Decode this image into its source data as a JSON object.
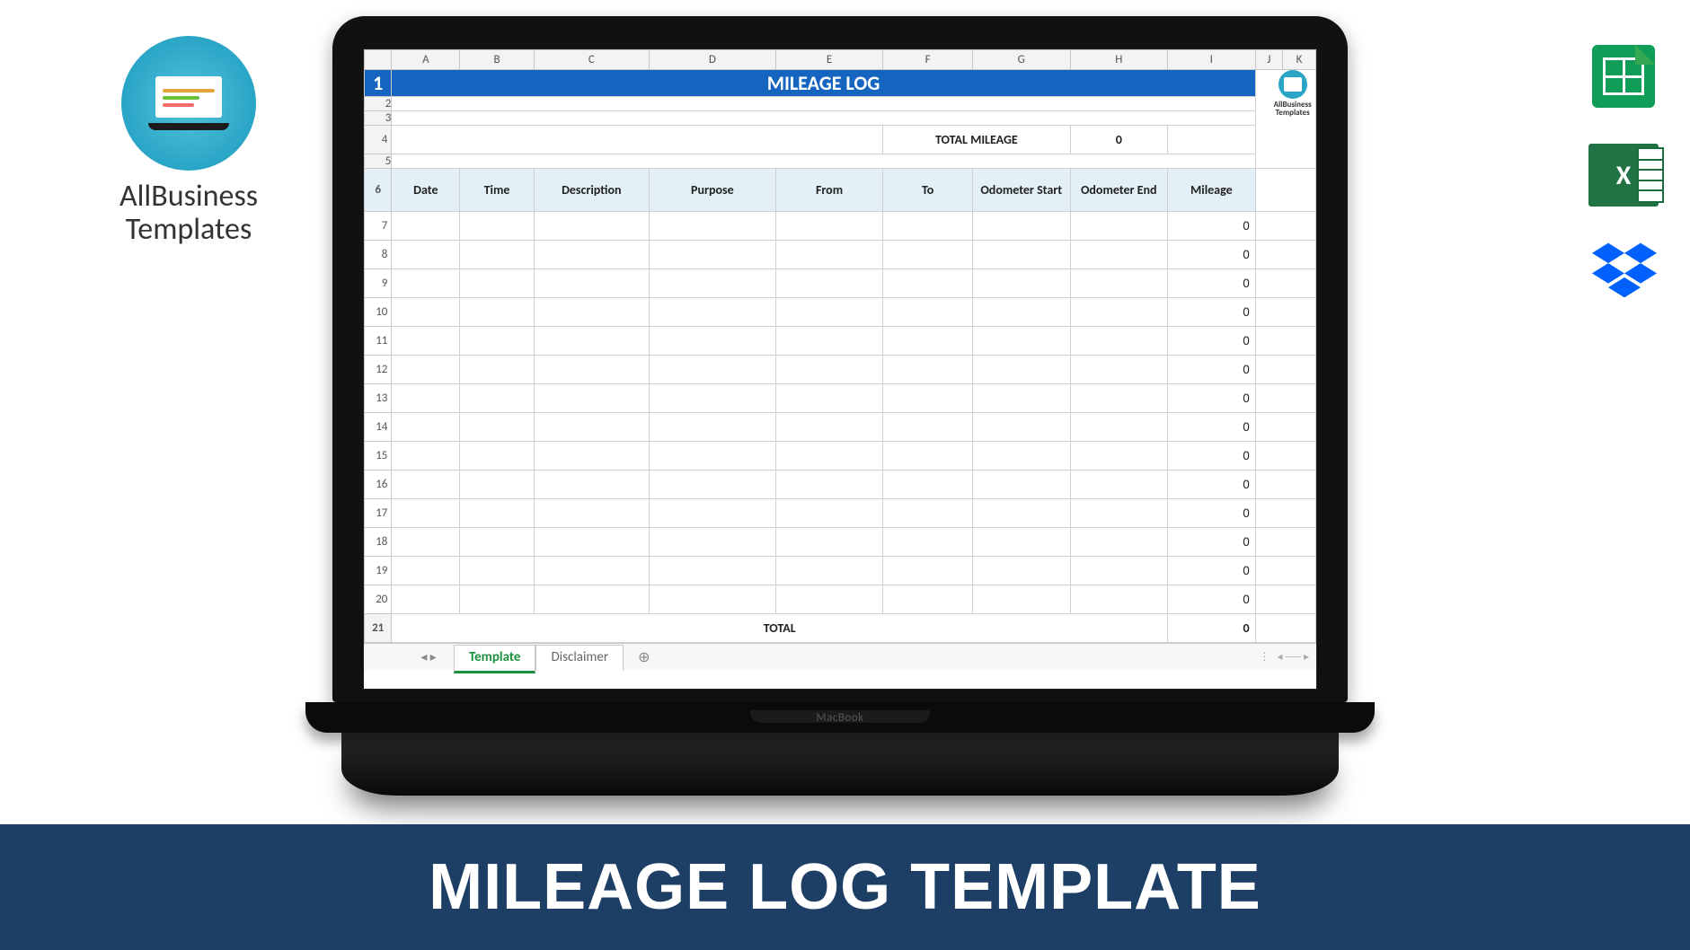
{
  "brand": {
    "line1": "AllBusiness",
    "line2": "Templates"
  },
  "apps": {
    "google_sheets": "google-sheets-icon",
    "excel": "excel-icon",
    "dropbox": "dropbox-icon",
    "excel_label": "X"
  },
  "laptop": {
    "device_label": "MacBook"
  },
  "spreadsheet": {
    "col_letters": [
      "A",
      "B",
      "C",
      "D",
      "E",
      "F",
      "G",
      "H",
      "I",
      "J",
      "K"
    ],
    "title": "MILEAGE LOG",
    "total_mileage_label": "TOTAL MILEAGE",
    "total_mileage_value": "0",
    "headers": [
      "Date",
      "Time",
      "Description",
      "Purpose",
      "From",
      "To",
      "Odometer Start",
      "Odometer End",
      "Mileage"
    ],
    "data_rows": [
      {
        "row_num": "7",
        "mileage": "0"
      },
      {
        "row_num": "8",
        "mileage": "0"
      },
      {
        "row_num": "9",
        "mileage": "0"
      },
      {
        "row_num": "10",
        "mileage": "0"
      },
      {
        "row_num": "11",
        "mileage": "0"
      },
      {
        "row_num": "12",
        "mileage": "0"
      },
      {
        "row_num": "13",
        "mileage": "0"
      },
      {
        "row_num": "14",
        "mileage": "0"
      },
      {
        "row_num": "15",
        "mileage": "0"
      },
      {
        "row_num": "16",
        "mileage": "0"
      },
      {
        "row_num": "17",
        "mileage": "0"
      },
      {
        "row_num": "18",
        "mileage": "0"
      },
      {
        "row_num": "19",
        "mileage": "0"
      },
      {
        "row_num": "20",
        "mileage": "0"
      }
    ],
    "total_row": {
      "row_num": "21",
      "label": "TOTAL",
      "value": "0"
    },
    "row_numbers_above": [
      "1",
      "2",
      "3",
      "4",
      "5",
      "6"
    ],
    "mini_logo_text": "AllBusiness Templates",
    "tabs": [
      {
        "label": "Template",
        "active": true
      },
      {
        "label": "Disclaimer",
        "active": false
      }
    ],
    "add_tab_glyph": "⊕"
  },
  "banner": {
    "title": "MILEAGE LOG TEMPLATE"
  }
}
